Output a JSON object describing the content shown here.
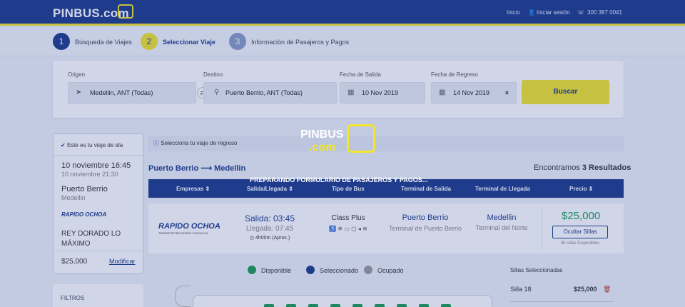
{
  "header": {
    "logo_text": "PINBUS.com",
    "nav": {
      "inicio": "Inicio",
      "login": "Iniciar sesión",
      "phone": "300 387 0041"
    }
  },
  "steps": [
    {
      "number": "1",
      "label": "Búsqueda de Viajes"
    },
    {
      "number": "2",
      "label": "Seleccionar Viaje"
    },
    {
      "number": "3",
      "label": "Información de Pasajeros y Pagos"
    }
  ],
  "search": {
    "origin_label": "Origen",
    "origin_value": "Medellin, ANT (Todas)",
    "destination_label": "Destino",
    "destination_value": "Puerto Berrio, ANT (Todas)",
    "departure_label": "Fecha de Salida",
    "departure_value": "10 Nov 2019",
    "return_label": "Fecha de Regreso",
    "return_value": "14 Nov 2019",
    "clear": "×",
    "search_button": "Buscar"
  },
  "outbound": {
    "heading": "Este es tu viaje de ida",
    "departure": "10 noviembre 16:45",
    "arrival": "10 noviembre 21:30",
    "origin": "Puerto Berrio",
    "destination": "Medellin",
    "operator_logo": "RAPIDO OCHOA",
    "operator": "REY DORADO LO MÁXIMO",
    "price": "$25,000",
    "modify": "Modificar"
  },
  "filters_label": "FILTROS",
  "results": {
    "notice": "Selecciona tu viaje de regreso",
    "route": "Puerto Berrio ⟶ Medellin",
    "found_prefix": "Encontramos",
    "found_count": "3 Resultados",
    "columns": [
      "Empresas ⇕",
      "Salida/Llegada ⇕",
      "Tipo de Bus",
      "Terminal de Salida",
      "Terminal de Llegada",
      "Precio ⇕"
    ],
    "row": {
      "operator_logo": "RAPIDO OCHOA",
      "operator_tagline": "TRANSPORTES RAPIDO OCHOA S.A.",
      "departure": "Salida: 03:45",
      "arrival": "Llegada: 07:45",
      "duration": "4h00m (Aprox.)",
      "bus_type": "Class Plus",
      "amenities": "♿ ❄ ▭ ▢ ◂ ≋",
      "terminal_from_city": "Puerto Berrio",
      "terminal_from": "Terminal de Puerto Berrio",
      "terminal_to_city": "Medellin",
      "terminal_to": "Terminal del Norte",
      "price": "$25,000",
      "hide_seats": "Ocultar Sillas",
      "seats_available": "30 sillas Disponibles"
    }
  },
  "legend": {
    "available": "Disponible",
    "selected": "Seleccionado",
    "occupied": "Ocupado"
  },
  "selected_seats": {
    "title": "Sillas Seleccionadas",
    "items": [
      {
        "seat": "Silla 18",
        "price": "$25,000"
      }
    ]
  },
  "overlay": {
    "logo_text": "PINBUS",
    "logo_sub": ".com",
    "message": "PREPARANDO FORMULARIO DE PASAJEROS Y PAGOS..."
  },
  "colors": {
    "brand_blue": "#1d3a8a",
    "brand_yellow": "#f2e52a",
    "available": "#1e9a52",
    "selected": "#1d3a8a",
    "occupied": "#9a9a9a"
  }
}
